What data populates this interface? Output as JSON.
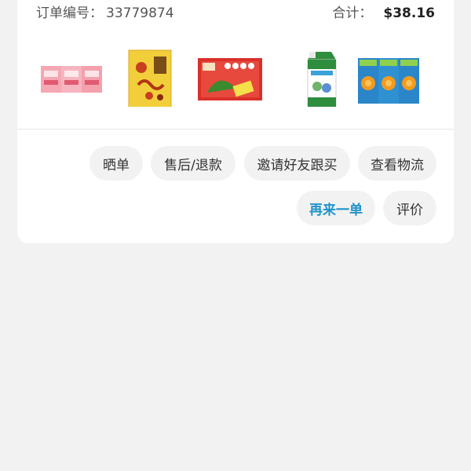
{
  "order": {
    "number_label": "订单编号：",
    "number_value": "33779874",
    "total_label": "合计：",
    "total_value": "$38.16"
  },
  "products": [
    {
      "name": "red-drink-box-pack-icon"
    },
    {
      "name": "yellow-snack-box-icon"
    },
    {
      "name": "red-gift-box-icon"
    },
    {
      "name": "milk-carton-icon"
    },
    {
      "name": "orange-juice-box-pack-icon"
    }
  ],
  "actions": {
    "show_order": "晒单",
    "after_sales": "售后/退款",
    "invite_friend": "邀请好友跟买",
    "track_logistics": "查看物流",
    "reorder": "再来一单",
    "review": "评价"
  },
  "colors": {
    "accent": "#1f93c9",
    "button_bg": "#f2f2f2",
    "page_bg": "#f2f2f2",
    "card_bg": "#ffffff"
  }
}
